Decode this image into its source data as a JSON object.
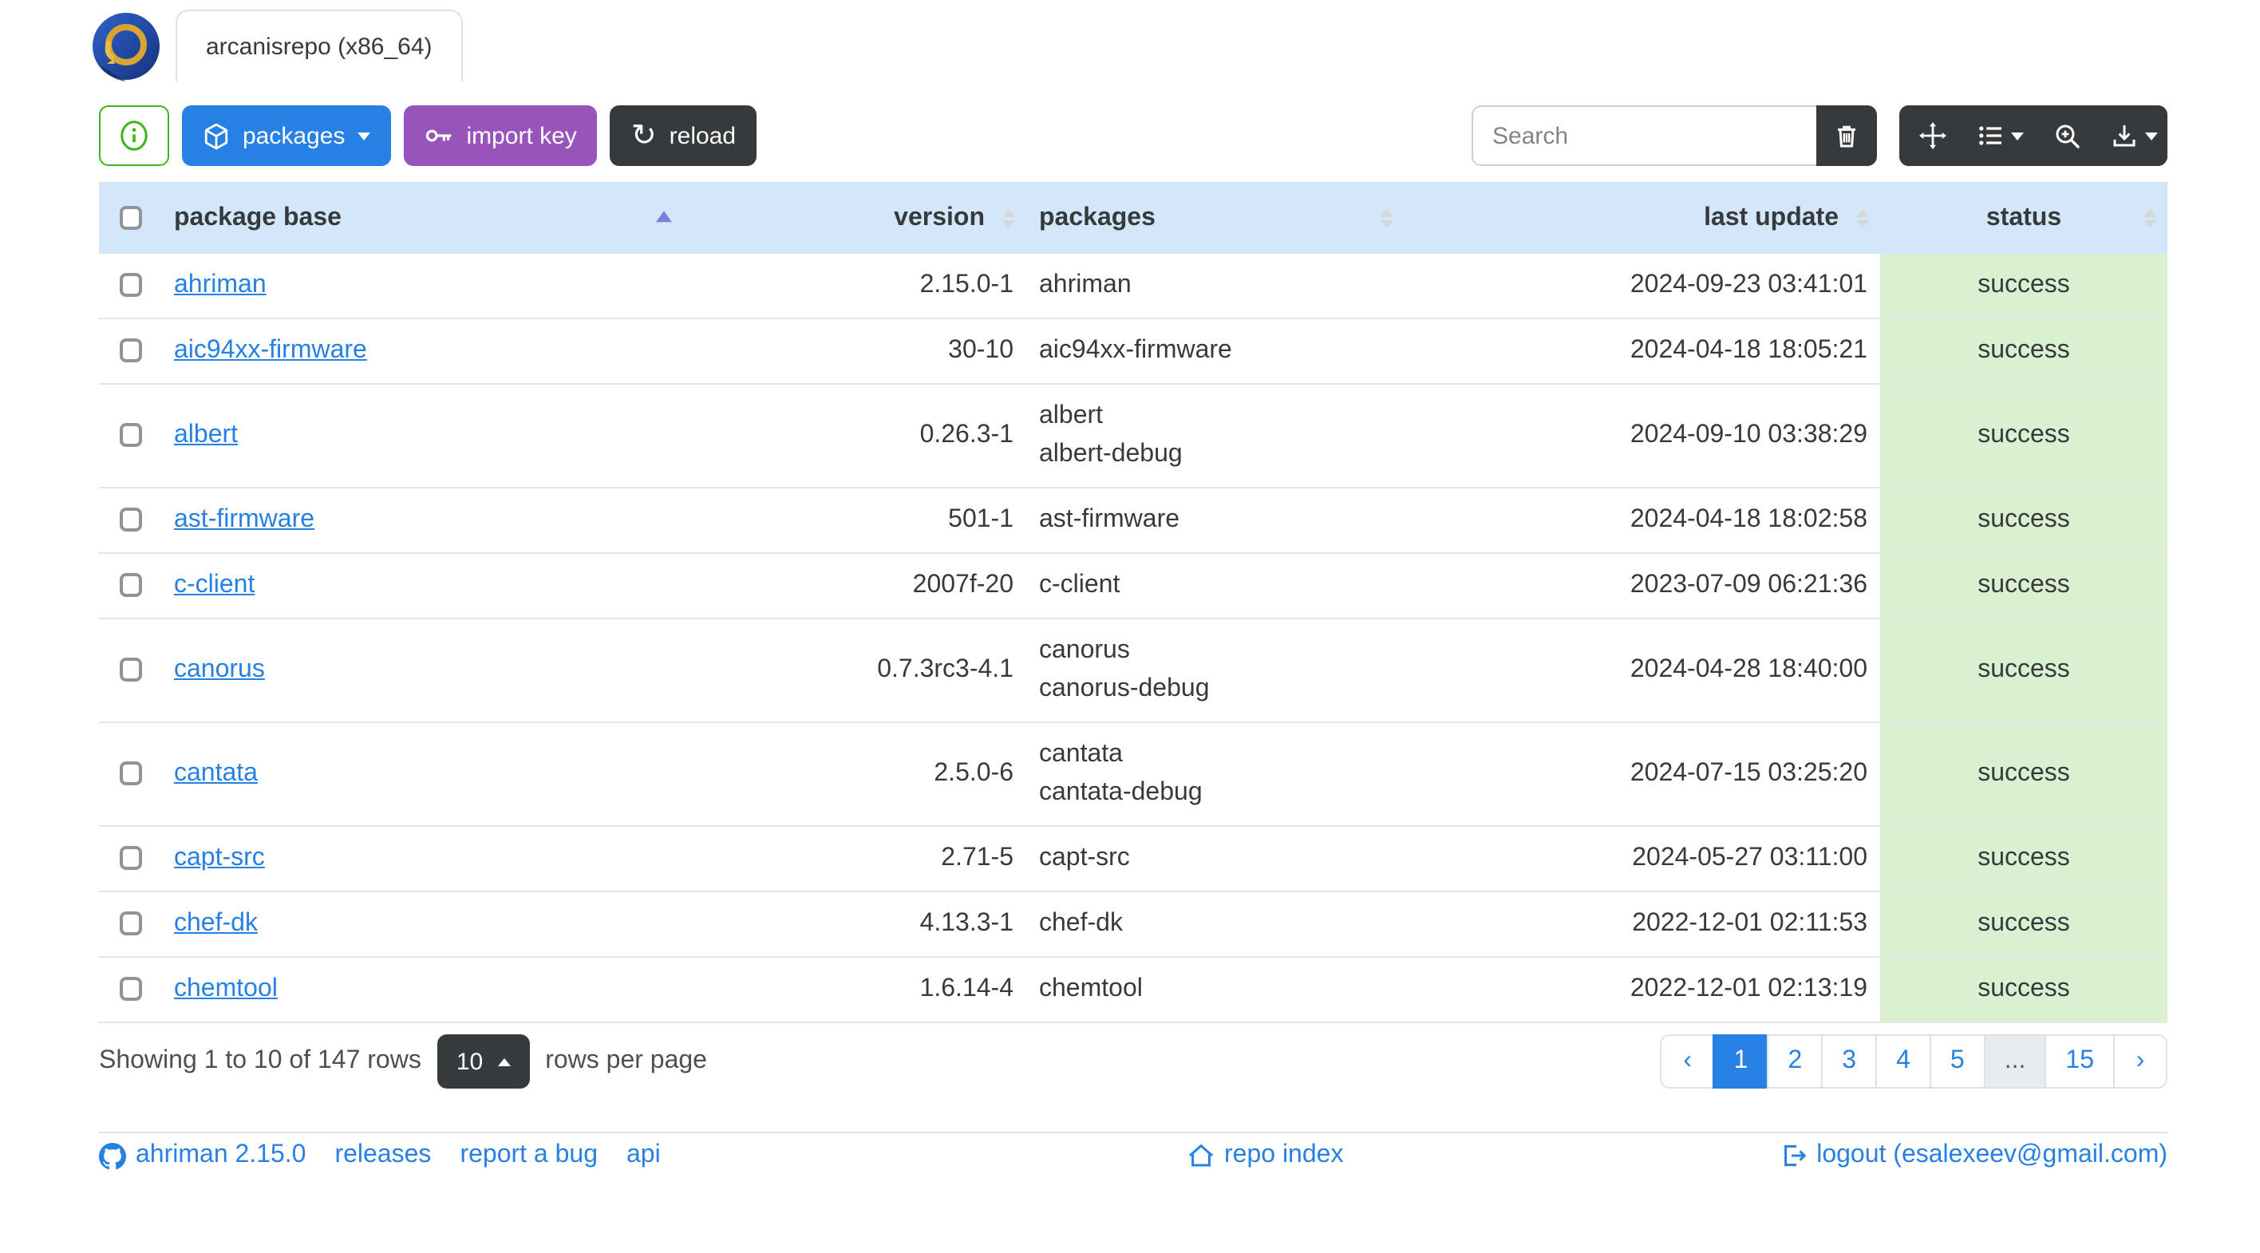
{
  "header": {
    "tab_title": "arcanisrepo (x86_64)",
    "logo_icon": "ahriman-logo"
  },
  "toolbar": {
    "info_icon": "info-circle",
    "packages_label": "packages",
    "packages_icon": "cube",
    "import_key_label": "import key",
    "import_key_icon": "key",
    "reload_label": "reload",
    "reload_icon": "arrow-clockwise",
    "reload_glyph": "↻",
    "search_placeholder": "Search",
    "clear_search_icon": "trash",
    "group_icons": [
      "arrows-move",
      "list-columns",
      "zoom-in",
      "download"
    ]
  },
  "table": {
    "columns": [
      "package base",
      "version",
      "packages",
      "last update",
      "status"
    ],
    "sorted_column": "package base",
    "sort_direction": "asc",
    "rows": [
      {
        "base": "ahriman",
        "version": "2.15.0-1",
        "packages": [
          "ahriman"
        ],
        "last_update": "2024-09-23 03:41:01",
        "status": "success"
      },
      {
        "base": "aic94xx-firmware",
        "version": "30-10",
        "packages": [
          "aic94xx-firmware"
        ],
        "last_update": "2024-04-18 18:05:21",
        "status": "success"
      },
      {
        "base": "albert",
        "version": "0.26.3-1",
        "packages": [
          "albert",
          "albert-debug"
        ],
        "last_update": "2024-09-10 03:38:29",
        "status": "success"
      },
      {
        "base": "ast-firmware",
        "version": "501-1",
        "packages": [
          "ast-firmware"
        ],
        "last_update": "2024-04-18 18:02:58",
        "status": "success"
      },
      {
        "base": "c-client",
        "version": "2007f-20",
        "packages": [
          "c-client"
        ],
        "last_update": "2023-07-09 06:21:36",
        "status": "success"
      },
      {
        "base": "canorus",
        "version": "0.7.3rc3-4.1",
        "packages": [
          "canorus",
          "canorus-debug"
        ],
        "last_update": "2024-04-28 18:40:00",
        "status": "success"
      },
      {
        "base": "cantata",
        "version": "2.5.0-6",
        "packages": [
          "cantata",
          "cantata-debug"
        ],
        "last_update": "2024-07-15 03:25:20",
        "status": "success"
      },
      {
        "base": "capt-src",
        "version": "2.71-5",
        "packages": [
          "capt-src"
        ],
        "last_update": "2024-05-27 03:11:00",
        "status": "success"
      },
      {
        "base": "chef-dk",
        "version": "4.13.3-1",
        "packages": [
          "chef-dk"
        ],
        "last_update": "2022-12-01 02:11:53",
        "status": "success"
      },
      {
        "base": "chemtool",
        "version": "1.6.14-4",
        "packages": [
          "chemtool"
        ],
        "last_update": "2022-12-01 02:13:19",
        "status": "success"
      }
    ]
  },
  "pagination": {
    "summary": "Showing 1 to 10 of 147 rows",
    "page_size": "10",
    "page_size_suffix": "rows per page",
    "prev": "‹",
    "next": "›",
    "pages": [
      "1",
      "2",
      "3",
      "4",
      "5",
      "...",
      "15"
    ],
    "active_page": "1",
    "ellipsis": "..."
  },
  "footer": {
    "github_icon": "github",
    "version_label": "ahriman 2.15.0",
    "releases_label": "releases",
    "report_label": "report a bug",
    "api_label": "api",
    "repo_index_icon": "home",
    "repo_index_label": "repo index",
    "logout_icon": "logout",
    "logout_label": "logout (esalexeev@gmail.com)"
  },
  "colors": {
    "primary": "#2780e3",
    "purple": "#9954bb",
    "dark": "#373a3c",
    "green": "#3fb618",
    "header_bg": "#d4e6f9",
    "success_bg": "#d9f0d1"
  }
}
